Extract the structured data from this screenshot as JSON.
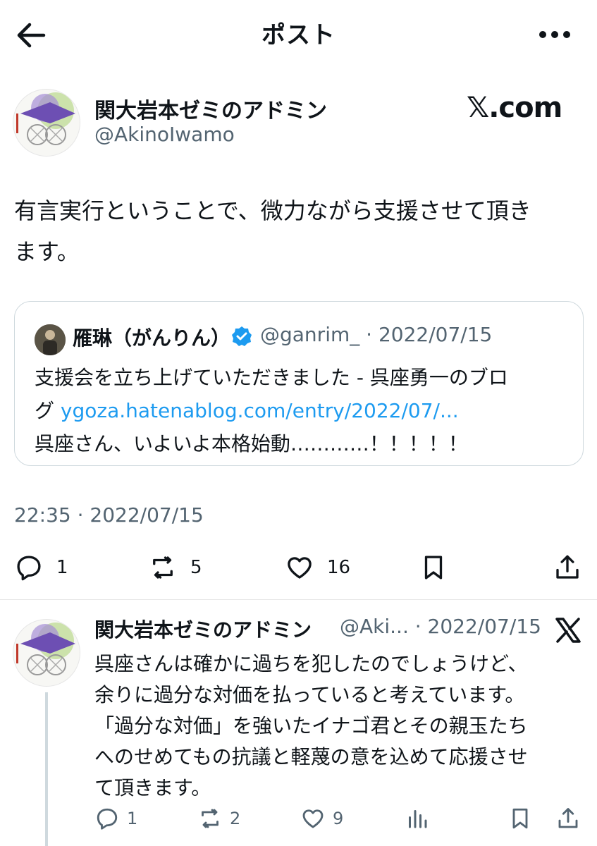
{
  "header": {
    "title": "ポスト"
  },
  "post": {
    "author_name": "関大岩本ゼミのアドミン",
    "author_handle": "@AkinoIwamo",
    "source_badge": "𝕏.com",
    "text_line1": "有言実行ということで、微力ながら支援させて頂き",
    "text_line2": "ます。",
    "quote": {
      "author_name": "雁琳（がんりん）",
      "author_handle": "@ganrim_ · 2022/07/15",
      "line1": "支援会を立ち上げていただきました - 呉座勇一のブロ",
      "line2_prefix": "グ ",
      "link": "ygoza.hatenablog.com/entry/2022/07/...",
      "line3": "呉座さん、いよいよ本格始動…………！！！！！"
    },
    "timestamp": "22:35 · 2022/07/15",
    "actions": {
      "replies": "1",
      "reposts": "5",
      "likes": "16"
    }
  },
  "reply": {
    "author_name": "関大岩本ゼミのアドミン",
    "meta": "@Aki... · 2022/07/15",
    "lines": [
      "呉座さんは確かに過ちを犯したのでしょうけど、",
      "余りに過分な対価を払っていると考えています。",
      "「過分な対価」を強いたイナゴ君とその親玉たち",
      "へのせめてもの抗議と軽蔑の意を込めて応援させ",
      "て頂きます。"
    ],
    "actions": {
      "replies": "1",
      "reposts": "2",
      "likes": "9"
    }
  },
  "colors": {
    "accent": "#1d9bf0",
    "muted": "#536471",
    "border": "#cfd9de"
  }
}
